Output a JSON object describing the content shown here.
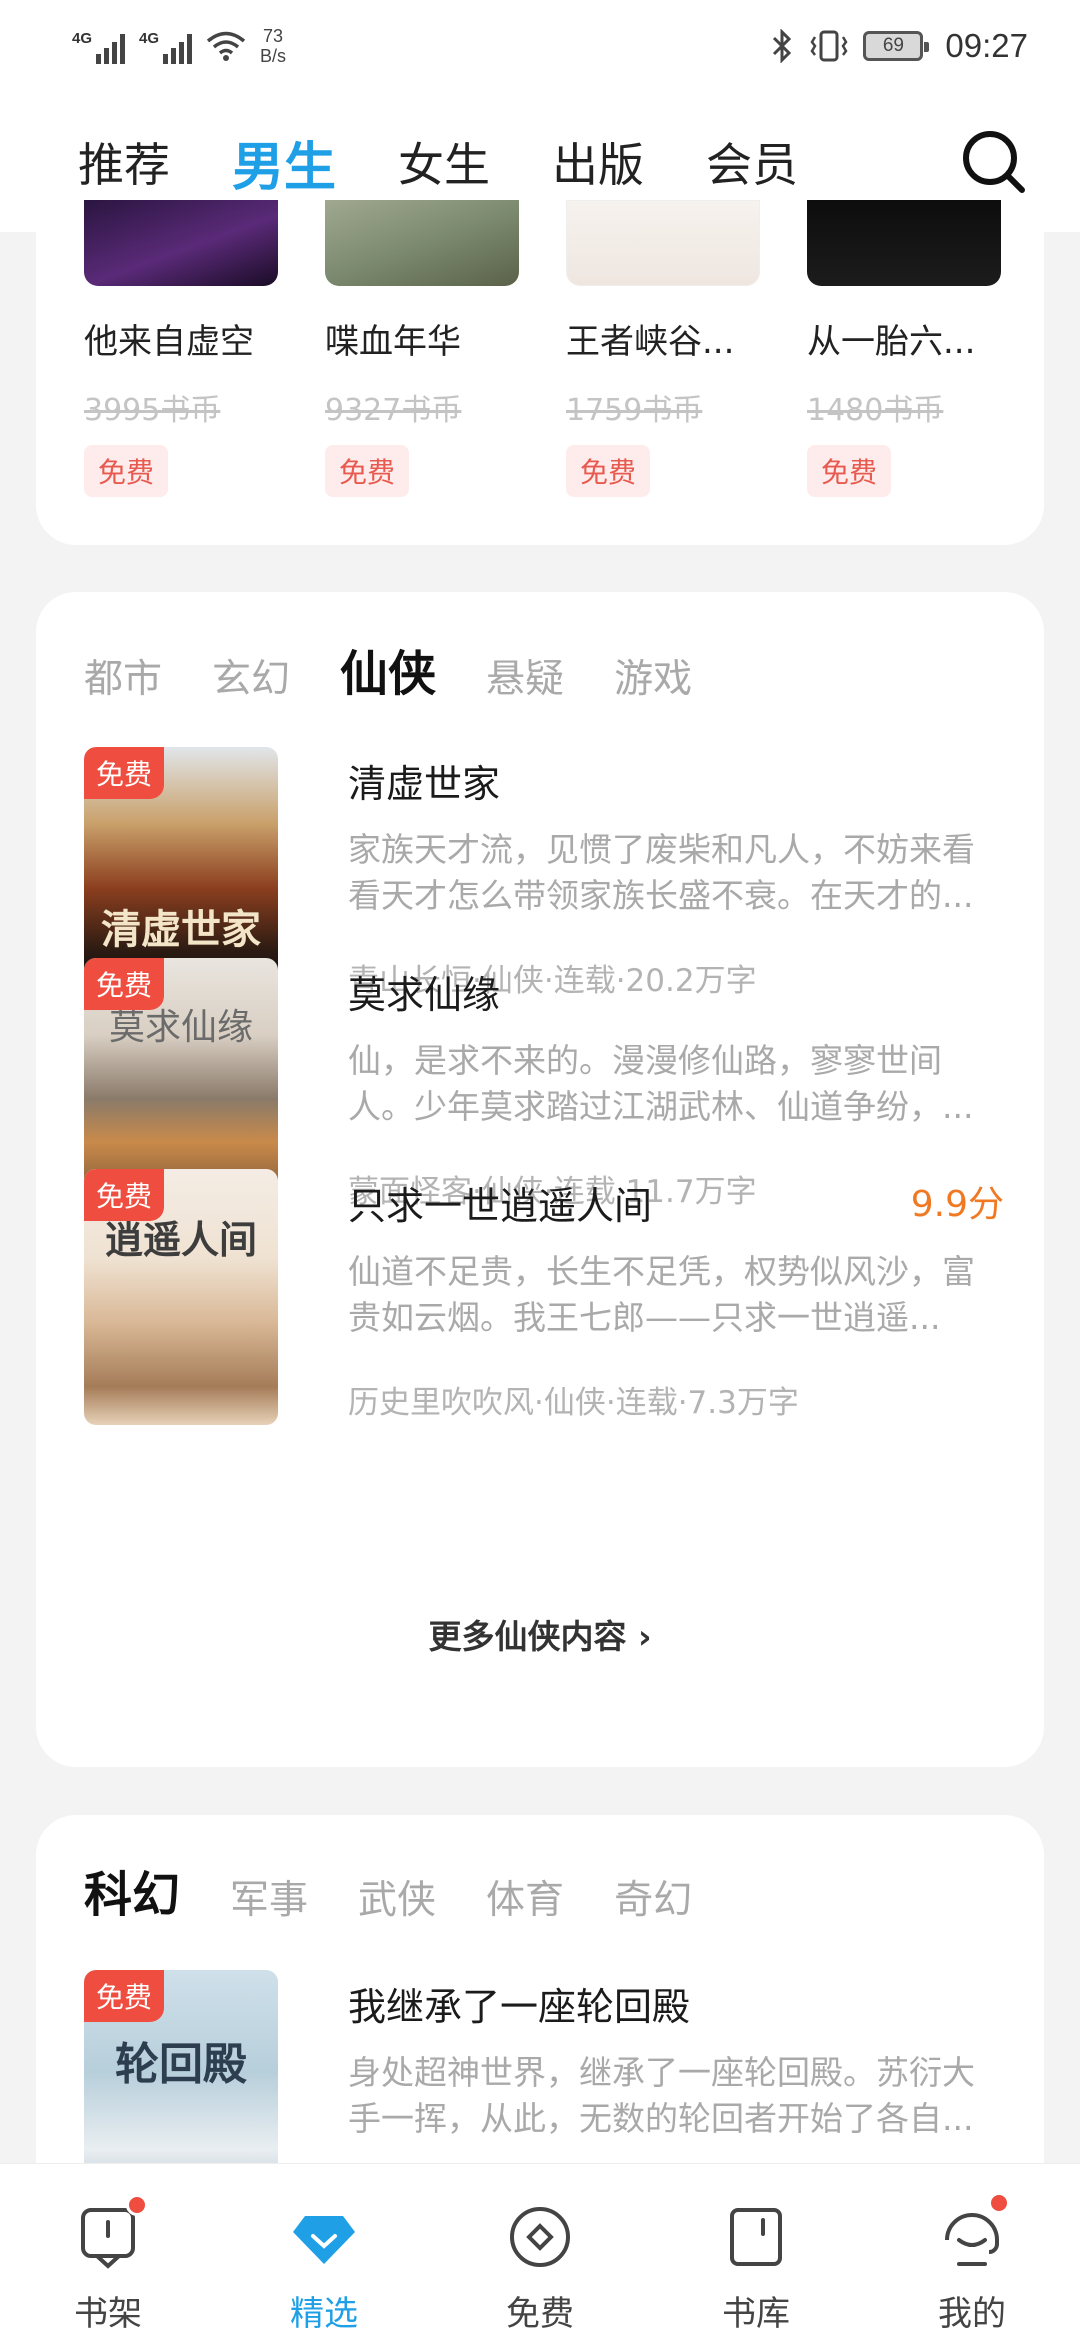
{
  "status_bar": {
    "net1": "4G",
    "net2": "4G",
    "speed_value": "73",
    "speed_unit": "B/s",
    "battery": "69",
    "time": "09:27"
  },
  "top_nav": {
    "tabs": [
      "推荐",
      "男生",
      "女生",
      "出版",
      "会员"
    ],
    "active": "男生"
  },
  "free_books": [
    {
      "title": "他来自虚空",
      "price": "3995书币",
      "badge": "免费"
    },
    {
      "title": "喋血年华",
      "price": "9327书币",
      "badge": "免费"
    },
    {
      "title": "王者峡谷...",
      "price": "1759书币",
      "badge": "免费"
    },
    {
      "title": "从一胎六...",
      "price": "1480书币",
      "badge": "免费"
    }
  ],
  "section1": {
    "tabs": [
      "都市",
      "玄幻",
      "仙侠",
      "悬疑",
      "游戏"
    ],
    "active": "仙侠",
    "books": [
      {
        "tag": "免费",
        "title": "清虚世家",
        "score": "",
        "desc": "家族天才流，见惯了废柴和凡人，不妨来看看天才怎么带领家族长盛不衰。在天才的...",
        "meta": "青山长恒·仙侠·连载·20.2万字",
        "cover_text": "清虚世家"
      },
      {
        "tag": "免费",
        "title": "莫求仙缘",
        "score": "",
        "desc": "仙，是求不来的。漫漫修仙路，寥寥世间人。少年莫求踏过江湖武林、仙道争纷，...",
        "meta": "蒙面怪客·仙侠·连载·11.7万字",
        "cover_text": "莫求仙缘"
      },
      {
        "tag": "免费",
        "title": "只求一世逍遥人间",
        "score": "9.9分",
        "desc": "仙道不足贵，长生不足凭，权势似风沙，富贵如云烟。我王七郎——只求一世逍遥...",
        "meta": "历史里吹吹风·仙侠·连载·7.3万字",
        "cover_text": "逍遥人间"
      }
    ],
    "more": "更多仙侠内容 ›"
  },
  "section2": {
    "tabs": [
      "科幻",
      "军事",
      "武侠",
      "体育",
      "奇幻"
    ],
    "active": "科幻",
    "books": [
      {
        "tag": "免费",
        "title": "我继承了一座轮回殿",
        "desc": "身处超神世界，继承了一座轮回殿。苏衍大手一挥，从此，无数的轮回者开始了各自...",
        "cover_text": "轮回殿"
      }
    ]
  },
  "bottom_nav": {
    "items": [
      "书架",
      "精选",
      "免费",
      "书库",
      "我的"
    ],
    "active": "精选"
  },
  "colors": {
    "accent": "#1fa0e6",
    "free_tag": "#ee4d3f",
    "score": "#f07a23"
  }
}
